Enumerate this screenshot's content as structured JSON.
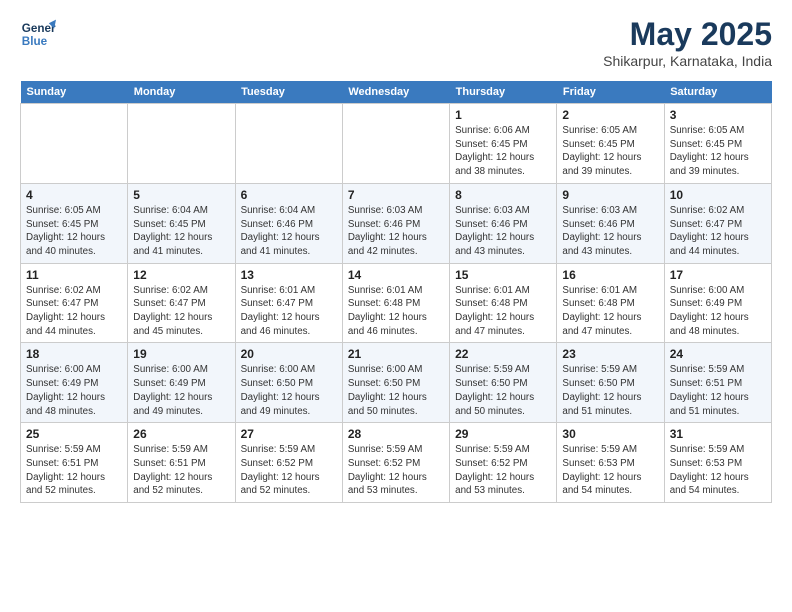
{
  "header": {
    "logo_line1": "General",
    "logo_line2": "Blue",
    "month": "May 2025",
    "location": "Shikarpur, Karnataka, India"
  },
  "days": [
    "Sunday",
    "Monday",
    "Tuesday",
    "Wednesday",
    "Thursday",
    "Friday",
    "Saturday"
  ],
  "weeks": [
    [
      {
        "date": "",
        "info": ""
      },
      {
        "date": "",
        "info": ""
      },
      {
        "date": "",
        "info": ""
      },
      {
        "date": "",
        "info": ""
      },
      {
        "date": "1",
        "info": "Sunrise: 6:06 AM\nSunset: 6:45 PM\nDaylight: 12 hours\nand 38 minutes."
      },
      {
        "date": "2",
        "info": "Sunrise: 6:05 AM\nSunset: 6:45 PM\nDaylight: 12 hours\nand 39 minutes."
      },
      {
        "date": "3",
        "info": "Sunrise: 6:05 AM\nSunset: 6:45 PM\nDaylight: 12 hours\nand 39 minutes."
      }
    ],
    [
      {
        "date": "4",
        "info": "Sunrise: 6:05 AM\nSunset: 6:45 PM\nDaylight: 12 hours\nand 40 minutes."
      },
      {
        "date": "5",
        "info": "Sunrise: 6:04 AM\nSunset: 6:45 PM\nDaylight: 12 hours\nand 41 minutes."
      },
      {
        "date": "6",
        "info": "Sunrise: 6:04 AM\nSunset: 6:46 PM\nDaylight: 12 hours\nand 41 minutes."
      },
      {
        "date": "7",
        "info": "Sunrise: 6:03 AM\nSunset: 6:46 PM\nDaylight: 12 hours\nand 42 minutes."
      },
      {
        "date": "8",
        "info": "Sunrise: 6:03 AM\nSunset: 6:46 PM\nDaylight: 12 hours\nand 43 minutes."
      },
      {
        "date": "9",
        "info": "Sunrise: 6:03 AM\nSunset: 6:46 PM\nDaylight: 12 hours\nand 43 minutes."
      },
      {
        "date": "10",
        "info": "Sunrise: 6:02 AM\nSunset: 6:47 PM\nDaylight: 12 hours\nand 44 minutes."
      }
    ],
    [
      {
        "date": "11",
        "info": "Sunrise: 6:02 AM\nSunset: 6:47 PM\nDaylight: 12 hours\nand 44 minutes."
      },
      {
        "date": "12",
        "info": "Sunrise: 6:02 AM\nSunset: 6:47 PM\nDaylight: 12 hours\nand 45 minutes."
      },
      {
        "date": "13",
        "info": "Sunrise: 6:01 AM\nSunset: 6:47 PM\nDaylight: 12 hours\nand 46 minutes."
      },
      {
        "date": "14",
        "info": "Sunrise: 6:01 AM\nSunset: 6:48 PM\nDaylight: 12 hours\nand 46 minutes."
      },
      {
        "date": "15",
        "info": "Sunrise: 6:01 AM\nSunset: 6:48 PM\nDaylight: 12 hours\nand 47 minutes."
      },
      {
        "date": "16",
        "info": "Sunrise: 6:01 AM\nSunset: 6:48 PM\nDaylight: 12 hours\nand 47 minutes."
      },
      {
        "date": "17",
        "info": "Sunrise: 6:00 AM\nSunset: 6:49 PM\nDaylight: 12 hours\nand 48 minutes."
      }
    ],
    [
      {
        "date": "18",
        "info": "Sunrise: 6:00 AM\nSunset: 6:49 PM\nDaylight: 12 hours\nand 48 minutes."
      },
      {
        "date": "19",
        "info": "Sunrise: 6:00 AM\nSunset: 6:49 PM\nDaylight: 12 hours\nand 49 minutes."
      },
      {
        "date": "20",
        "info": "Sunrise: 6:00 AM\nSunset: 6:50 PM\nDaylight: 12 hours\nand 49 minutes."
      },
      {
        "date": "21",
        "info": "Sunrise: 6:00 AM\nSunset: 6:50 PM\nDaylight: 12 hours\nand 50 minutes."
      },
      {
        "date": "22",
        "info": "Sunrise: 5:59 AM\nSunset: 6:50 PM\nDaylight: 12 hours\nand 50 minutes."
      },
      {
        "date": "23",
        "info": "Sunrise: 5:59 AM\nSunset: 6:50 PM\nDaylight: 12 hours\nand 51 minutes."
      },
      {
        "date": "24",
        "info": "Sunrise: 5:59 AM\nSunset: 6:51 PM\nDaylight: 12 hours\nand 51 minutes."
      }
    ],
    [
      {
        "date": "25",
        "info": "Sunrise: 5:59 AM\nSunset: 6:51 PM\nDaylight: 12 hours\nand 52 minutes."
      },
      {
        "date": "26",
        "info": "Sunrise: 5:59 AM\nSunset: 6:51 PM\nDaylight: 12 hours\nand 52 minutes."
      },
      {
        "date": "27",
        "info": "Sunrise: 5:59 AM\nSunset: 6:52 PM\nDaylight: 12 hours\nand 52 minutes."
      },
      {
        "date": "28",
        "info": "Sunrise: 5:59 AM\nSunset: 6:52 PM\nDaylight: 12 hours\nand 53 minutes."
      },
      {
        "date": "29",
        "info": "Sunrise: 5:59 AM\nSunset: 6:52 PM\nDaylight: 12 hours\nand 53 minutes."
      },
      {
        "date": "30",
        "info": "Sunrise: 5:59 AM\nSunset: 6:53 PM\nDaylight: 12 hours\nand 54 minutes."
      },
      {
        "date": "31",
        "info": "Sunrise: 5:59 AM\nSunset: 6:53 PM\nDaylight: 12 hours\nand 54 minutes."
      }
    ]
  ]
}
